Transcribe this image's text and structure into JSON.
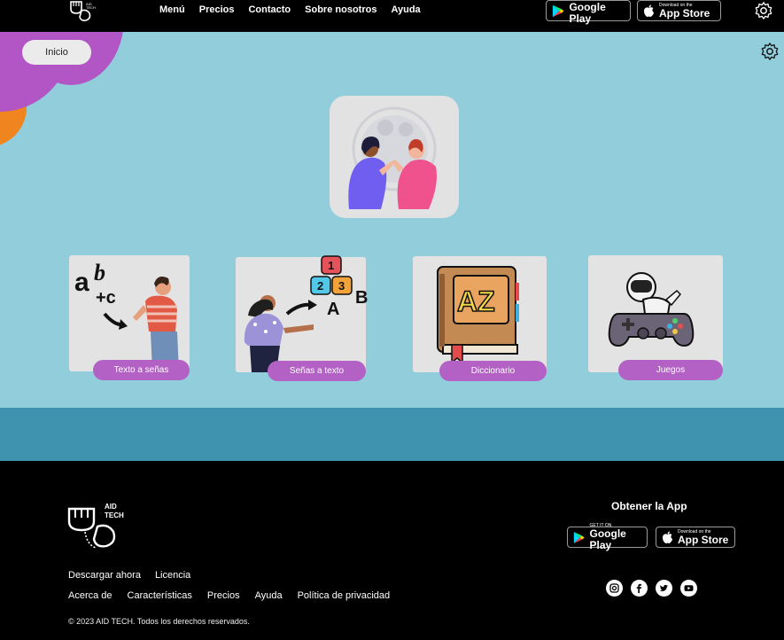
{
  "brand": {
    "line1": "AID",
    "line2": "TECH"
  },
  "nav": {
    "items": [
      "Menú",
      "Precios",
      "Contacto",
      "Sobre nosotros",
      "Ayuda"
    ]
  },
  "stores": {
    "google_small": "GET IT ON",
    "google_big": "Google Play",
    "apple_small": "Download on the",
    "apple_big": "App Store"
  },
  "main": {
    "home_label": "Inicio",
    "cards": [
      {
        "label": "Texto a señas",
        "icon": "abc-to-sign-illustration"
      },
      {
        "label": "Señas a texto",
        "icon": "sign-to-text-illustration",
        "art_letters": [
          "1",
          "2",
          "3",
          "A",
          "B"
        ]
      },
      {
        "label": "Diccionario",
        "icon": "dictionary-book-illustration",
        "art_letters": "AZ"
      },
      {
        "label": "Juegos",
        "icon": "game-controller-illustration"
      }
    ]
  },
  "footer": {
    "get_app": "Obtener la App",
    "links_row1": [
      "Descargar ahora",
      "Licencia"
    ],
    "links_row2": [
      "Acerca de",
      "Características",
      "Precios",
      "Ayuda",
      "Política de privacidad"
    ],
    "copyright": "© 2023 AID TECH. Todos los derechos reservados.",
    "social": [
      "instagram-icon",
      "facebook-icon",
      "twitter-icon",
      "youtube-icon"
    ]
  },
  "colors": {
    "background": "#92cddc",
    "band": "#4093ae",
    "accent": "#b361c5",
    "blob_orange": "#f0851f",
    "dark": "#000000"
  }
}
